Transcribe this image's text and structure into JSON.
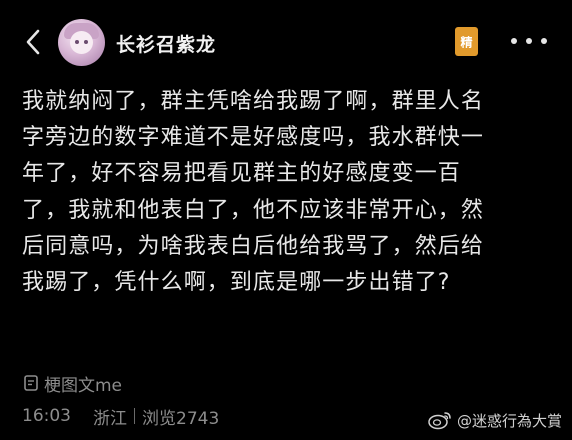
{
  "header": {
    "username": "长衫召紫龙",
    "badge_label": "精"
  },
  "post": {
    "lines": [
      "我就纳闷了，群主凭啥给我踢了啊，群里人名",
      "字旁边的数字难道不是好感度吗，我水群快一",
      "年了，好不容易把看见群主的好感度变一百",
      "了，我就和他表白了，他不应该非常开心，然",
      "后同意吗，为啥我表白后他给我骂了，然后给",
      "我踢了，凭什么啊，到底是哪一步出错了?"
    ]
  },
  "source": {
    "label": "梗图文me"
  },
  "meta": {
    "time": "16:03",
    "location": "浙江",
    "views": "浏览2743"
  },
  "watermark": {
    "text": "@迷惑行為大賞"
  },
  "colors": {
    "background": "#000000",
    "text": "#e8e8e8",
    "muted": "#8d8d8d",
    "badge": "#e19a2c"
  }
}
